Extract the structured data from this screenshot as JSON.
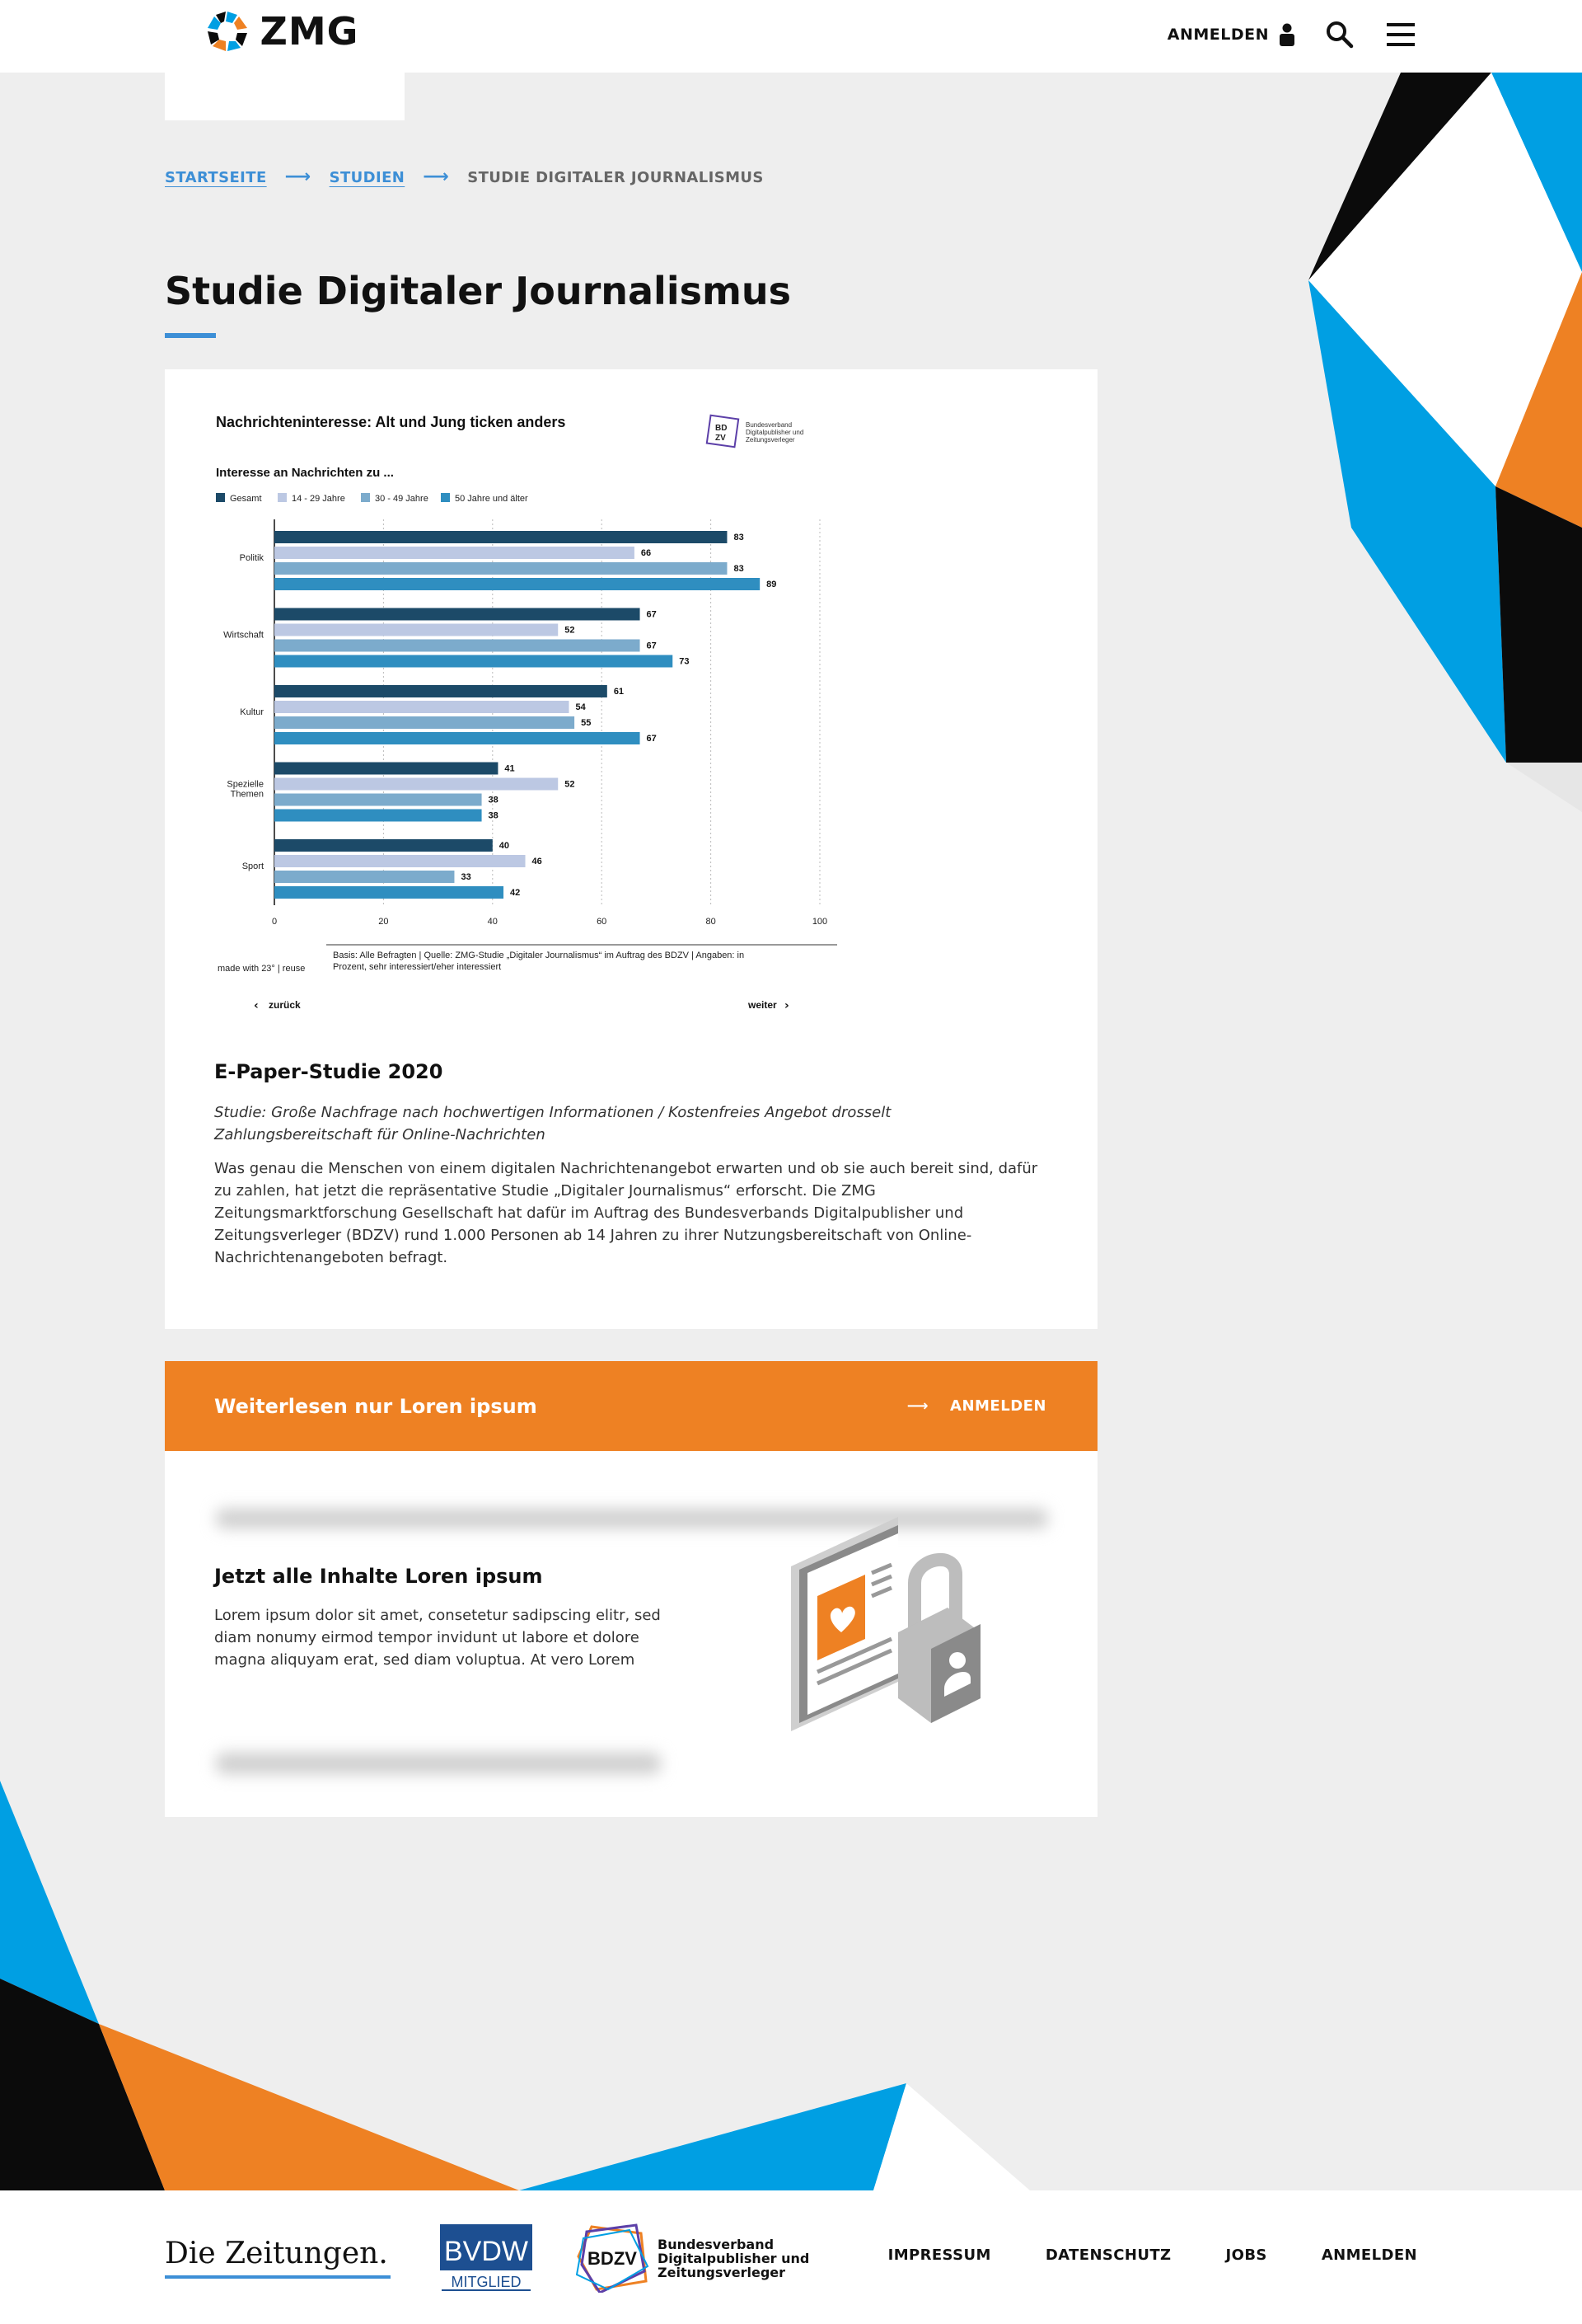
{
  "header": {
    "logo_text": "ZMG",
    "login_label": "ANMELDEN",
    "icons": [
      "user-icon",
      "search-icon",
      "menu-icon"
    ]
  },
  "breadcrumb": {
    "items": [
      "STARTSEITE",
      "STUDIEN"
    ],
    "current": "STUDIE DIGITALER JOURNALISMUS"
  },
  "page_title": "Studie Digitaler Journalismus",
  "colors": {
    "accent_blue": "#3d8fd6",
    "orange": "#ee8123",
    "black": "#0b0b0b",
    "series": [
      "#1c4a68",
      "#bcc8e3",
      "#7cabcc",
      "#2f8ec0"
    ]
  },
  "chart_data": {
    "type": "bar",
    "orientation": "horizontal",
    "title": "Nachrichteninteresse: Alt und Jung ticken anders",
    "subtitle": "Interesse an Nachrichten zu ...",
    "publisher_label": "Bundesverband Digitalpublisher und Zeitungsverleger",
    "categories": [
      "Politik",
      "Wirtschaft",
      "Kultur",
      "Spezielle Themen",
      "Sport"
    ],
    "series": [
      {
        "name": "Gesamt",
        "values": [
          83,
          67,
          61,
          41,
          40
        ]
      },
      {
        "name": "14 - 29 Jahre",
        "values": [
          66,
          52,
          54,
          52,
          46
        ]
      },
      {
        "name": "30 - 49 Jahre",
        "values": [
          83,
          67,
          55,
          38,
          33
        ]
      },
      {
        "name": "50 Jahre und älter",
        "values": [
          89,
          73,
          67,
          38,
          42
        ]
      }
    ],
    "xlim": [
      0,
      100
    ],
    "xticks": [
      0,
      20,
      40,
      60,
      80,
      100
    ],
    "legend_position": "top-left",
    "grid": true,
    "source_line1": "Basis: Alle Befragten | Quelle: ZMG-Studie „Digitaler Journalismus“ im Auftrag des BDZV | Angaben: in",
    "source_line2": "Prozent, sehr interessiert/eher interessiert",
    "credit": "made with 23° | reuse",
    "nav_prev": "zurück",
    "nav_next": "weiter"
  },
  "article": {
    "heading": "E-Paper-Studie 2020",
    "lede_line1": "Studie: Große Nachfrage nach hochwertigen Informationen / Kostenfreies Angebot drosselt",
    "lede_line2": "Zahlungsbereitschaft für Online-Nachrichten",
    "body_lines": [
      "Was genau die Menschen von einem digitalen Nachrichtenangebot erwarten und ob sie auch bereit sind, dafür",
      "zu zahlen, hat jetzt die repräsentative Studie „Digitaler Journalismus“ erforscht. Die ZMG",
      "Zeitungsmarktforschung Gesellschaft hat dafür im Auftrag des Bundesverbands Digitalpublisher und",
      "Zeitungsverleger (BDZV) rund 1.000 Personen ab 14 Jahren zu ihrer Nutzungsbereitschaft von Online-",
      "Nachrichtenangeboten befragt."
    ]
  },
  "paywall": {
    "bar_title": "Weiterlesen nur Loren ipsum",
    "action_label": "ANMELDEN",
    "heading": "Jetzt alle Inhalte Loren ipsum",
    "text_lines": [
      "Lorem ipsum dolor sit amet, consetetur sadipscing elitr, sed",
      "diam nonumy eirmod tempor invidunt ut labore et dolore",
      "magna aliquyam erat, sed diam voluptua. At vero Lorem"
    ]
  },
  "footer": {
    "logo_diezeitungen": "Die Zeitungen.",
    "logo_bvdw_top": "BVDW",
    "logo_bvdw_bottom": "MITGLIED",
    "logo_bdzv": "BDZV",
    "bdzv_lines": [
      "Bundesverband",
      "Digitalpublisher und",
      "Zeitungsverleger"
    ],
    "links": [
      "IMPRESSUM",
      "DATENSCHUTZ",
      "JOBS",
      "ANMELDEN"
    ]
  }
}
